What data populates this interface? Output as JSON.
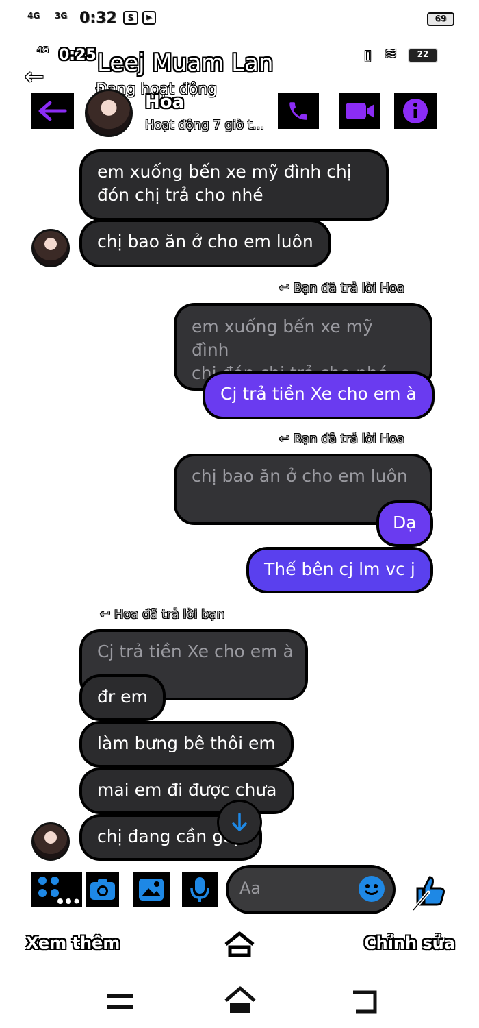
{
  "status_outer": {
    "network1": "4G",
    "network2": "3G",
    "time": "0:32",
    "battery": "69"
  },
  "status_inner": {
    "network": "4G",
    "time": "0:25",
    "battery": "22"
  },
  "overlay": {
    "name": "Leej Muam Lan",
    "status": "Đang hoạt động"
  },
  "header": {
    "contact_name": "Hoa",
    "contact_status": "Hoạt động 7 giờ t..."
  },
  "conversation": {
    "m1": "em xuống bến xe mỹ đình chị",
    "m1b": "đón chị trả cho nhé",
    "m2": "chị bao ăn ở  cho em luôn",
    "reply1_label": "Bạn đã trả lời Hoa",
    "q1a": "em xuống bến xe mỹ đình",
    "q1b": "chị đón chị trả cho nhé",
    "r1": "Cj trả tiền Xe cho em à",
    "reply2_label": "Bạn đã trả lời Hoa",
    "q2": "chị bao ăn ở  cho em luôn",
    "r2": "Dạ",
    "r3": "Thế bên cj lm vc j",
    "reply3_label": "Hoa đã trả lời bạn",
    "q3": "Cj trả tiền Xe cho em à",
    "m3": "đr em",
    "m4": "làm bưng bê thôi em",
    "m5": "mai em đi được chưa",
    "m6": "chị đang cần gấp"
  },
  "composer": {
    "placeholder": "Aa"
  },
  "bottom_bar": {
    "left": "Xem thêm",
    "right": "Chỉnh sửa"
  },
  "colors": {
    "accent": "#6a3bf0",
    "icon_purple": "#8b2cf5",
    "messenger_blue": "#1e88e5"
  }
}
